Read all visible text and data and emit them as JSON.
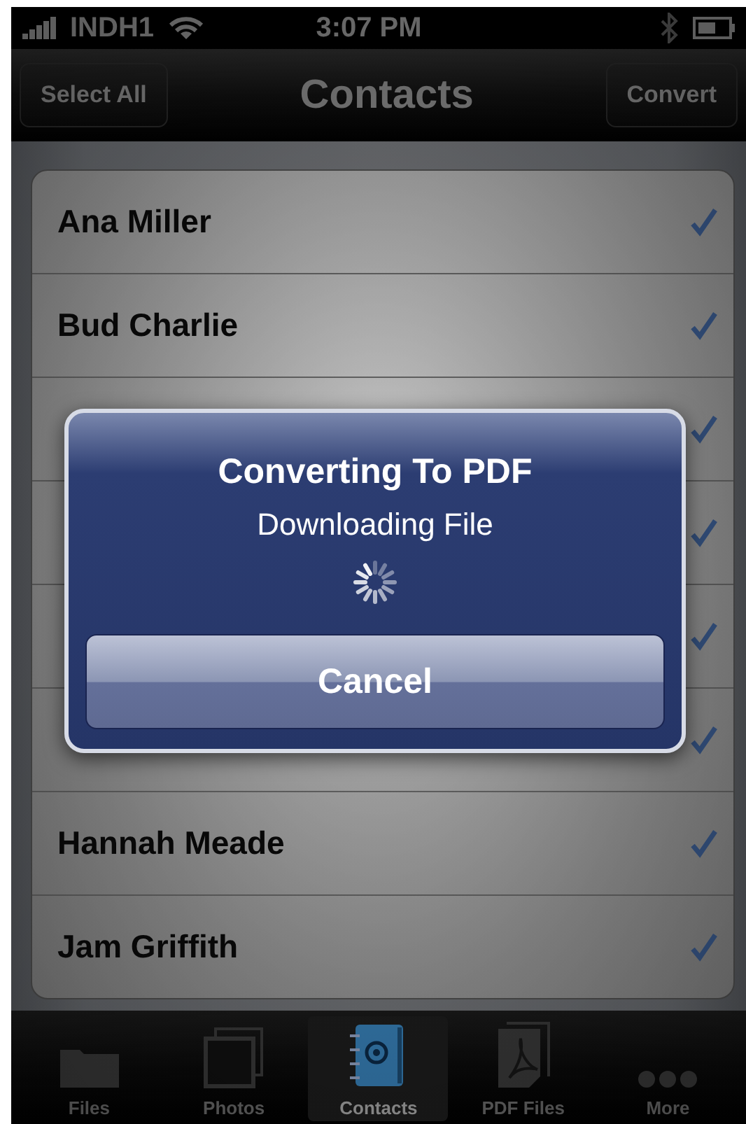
{
  "status_bar": {
    "carrier": "INDH1",
    "time": "3:07 PM"
  },
  "nav_bar": {
    "left_button": "Select All",
    "title": "Contacts",
    "right_button": "Convert"
  },
  "contacts": [
    {
      "name": "Ana Miller",
      "checked": true
    },
    {
      "name": "Bud Charlie",
      "checked": true
    },
    {
      "checked": true
    },
    {
      "checked": true
    },
    {
      "checked": true
    },
    {
      "checked": true
    },
    {
      "name": "Hannah Meade",
      "checked": true
    },
    {
      "name": "Jam Griffith",
      "checked": true
    }
  ],
  "alert": {
    "title": "Converting To PDF",
    "message": "Downloading File",
    "button": "Cancel"
  },
  "tab_bar": [
    {
      "label": "Files",
      "kind": "folder",
      "selected": false
    },
    {
      "label": "Photos",
      "kind": "photos",
      "selected": false
    },
    {
      "label": "Contacts",
      "kind": "contacts",
      "selected": true
    },
    {
      "label": "PDF Files",
      "kind": "pdf",
      "selected": false
    },
    {
      "label": "More",
      "kind": "more",
      "selected": false
    }
  ]
}
